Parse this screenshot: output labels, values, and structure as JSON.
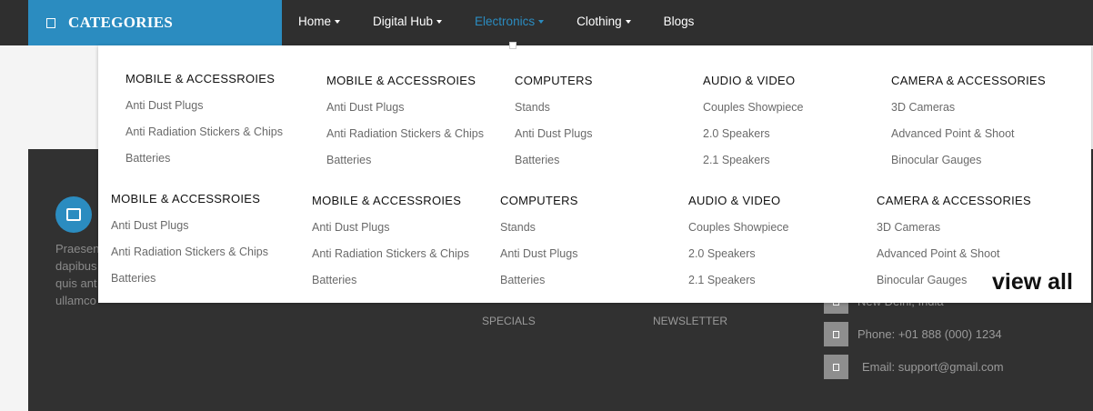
{
  "categories": {
    "label": "CATEGORIES"
  },
  "nav": [
    {
      "label": "Home",
      "caret": true
    },
    {
      "label": "Digital Hub",
      "caret": true
    },
    {
      "label": "Electronics",
      "caret": true,
      "active": true
    },
    {
      "label": "Clothing",
      "caret": true
    },
    {
      "label": "Blogs",
      "caret": false
    }
  ],
  "menu_rows": [
    [
      {
        "title": "MOBILE & ACCESSROIES",
        "links": [
          "Anti Dust Plugs",
          "Anti Radiation Stickers & Chips",
          "Batteries"
        ]
      },
      {
        "title": "MOBILE & ACCESSROIES",
        "links": [
          "Anti Dust Plugs",
          "Anti Radiation Stickers & Chips",
          "Batteries"
        ]
      },
      {
        "title": "COMPUTERS",
        "links": [
          "Stands",
          "Anti Dust Plugs",
          "Batteries"
        ]
      },
      {
        "title": "AUDIO & VIDEO",
        "links": [
          "Couples Showpiece",
          "2.0 Speakers",
          "2.1 Speakers"
        ]
      },
      {
        "title": "CAMERA & ACCESSORIES",
        "links": [
          "3D Cameras",
          "Advanced Point & Shoot",
          "Binocular Gauges"
        ]
      }
    ],
    [
      {
        "title": "MOBILE & ACCESSROIES",
        "links": [
          "Anti Dust Plugs",
          "Anti Radiation Stickers & Chips",
          "Batteries"
        ]
      },
      {
        "title": "MOBILE & ACCESSROIES",
        "links": [
          "Anti Dust Plugs",
          "Anti Radiation Stickers & Chips",
          "Batteries"
        ]
      },
      {
        "title": "COMPUTERS",
        "links": [
          "Stands",
          "Anti Dust Plugs",
          "Batteries"
        ]
      },
      {
        "title": "AUDIO & VIDEO",
        "links": [
          "Couples Showpiece",
          "2.0 Speakers",
          "2.1 Speakers"
        ]
      },
      {
        "title": "CAMERA & ACCESSORIES",
        "links": [
          "3D Cameras",
          "Advanced Point & Shoot",
          "Binocular Gauges"
        ]
      }
    ]
  ],
  "view_all": "view all",
  "footer": {
    "text": "Praesen\ndapibus\nquis ant\nullamco",
    "links": [
      "SPECIALS",
      "NEWSLETTER"
    ],
    "contact": [
      {
        "icon": "location-icon",
        "text": "New Delhi, India"
      },
      {
        "icon": "phone-icon",
        "text": "Phone: +01 888 (000) 1234"
      },
      {
        "icon": "email-icon",
        "text": "Email: support@gmail.com"
      }
    ]
  },
  "colors": {
    "accent": "#2b8cc0",
    "topbar": "#2f2f2f",
    "footer": "#313131"
  }
}
